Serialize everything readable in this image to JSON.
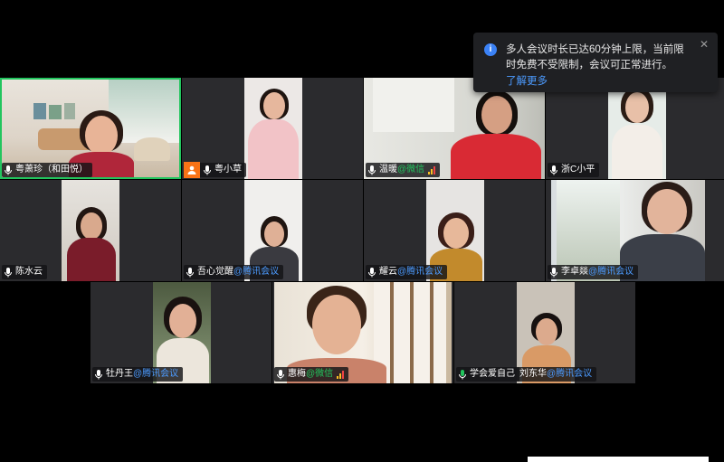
{
  "notice": {
    "message": "多人会议时长已达60分钟上限，当前限时免费不受限制，会议可正常进行。",
    "link": "了解更多",
    "close_symbol": "✕",
    "info_symbol": "i"
  },
  "participants": [
    {
      "name": "粤萧珍（和田悦）",
      "source": ""
    },
    {
      "name": "粤小草",
      "source": ""
    },
    {
      "name": "温暖",
      "source": "@微信"
    },
    {
      "name": "浙C小平",
      "source": ""
    },
    {
      "name": "陈水云",
      "source": ""
    },
    {
      "name": "吾心觉醒",
      "source": "@腾讯会议"
    },
    {
      "name": "耀云",
      "source": "@腾讯会议"
    },
    {
      "name": "李卓燚",
      "source": "@腾讯会议"
    },
    {
      "name": "牡丹王",
      "source": "@腾讯会议"
    },
    {
      "name": "惠梅",
      "source": "@微信"
    },
    {
      "name": "学会爱自己",
      "source": ""
    },
    {
      "name": "刘东华",
      "source": "@腾讯会议"
    }
  ],
  "colors": {
    "active_border": "#22c55e",
    "tencent_tag": "#4c9bff",
    "wechat_tag": "#22c55e",
    "notice_bg": "#1f2023"
  },
  "icons": {
    "mic": "mic-icon",
    "info": "info-icon",
    "close": "close-icon",
    "signal": "signal-icon",
    "avatar": "user-avatar-icon"
  }
}
